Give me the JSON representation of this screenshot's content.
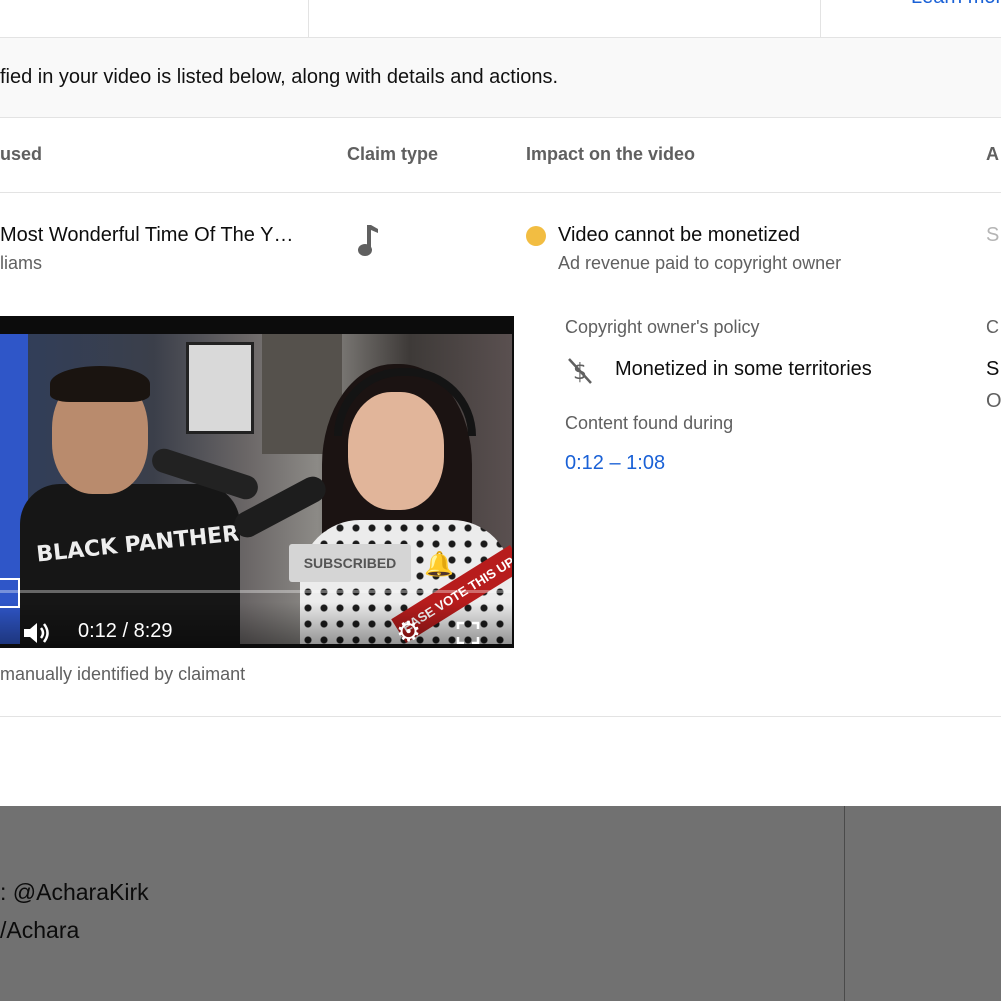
{
  "header": {
    "learn_more": "Learn more"
  },
  "info_text": "fied in your video is listed below, along with details and actions.",
  "columns": {
    "content_used": "used",
    "claim_type": "Claim type",
    "impact": "Impact on the video",
    "actions_fragment": "A"
  },
  "claim": {
    "song_title": "Most Wonderful Time Of The Y…",
    "artist": "liams",
    "claim_type_icon": "music-note-icon",
    "status_color": "#f2bd42",
    "impact_title": "Video cannot be monetized",
    "impact_subtitle": "Ad revenue paid to copyright owner",
    "action_fragment": "S",
    "identified_by": "manually identified by claimant"
  },
  "video": {
    "time": "0:12 / 8:29",
    "subscribed": "SUBSCRIBED",
    "shirt_text": "BLACK PANTHER",
    "banner": "EASE VOTE THIS UP"
  },
  "policy": {
    "label": "Copyright owner's policy",
    "policy_text": "Monetized in some territories",
    "found_label": "Content found during",
    "found_range": "0:12 – 1:08",
    "right_fragment_label": "C",
    "right_fragment_value": "S",
    "right_fragment_sub": "O"
  },
  "background_page": {
    "line1": ": @AcharaKirk",
    "line2": "/Achara"
  },
  "colors": {
    "link": "#1a61d6",
    "status": "#f2bd42",
    "overlay": "#717171"
  }
}
